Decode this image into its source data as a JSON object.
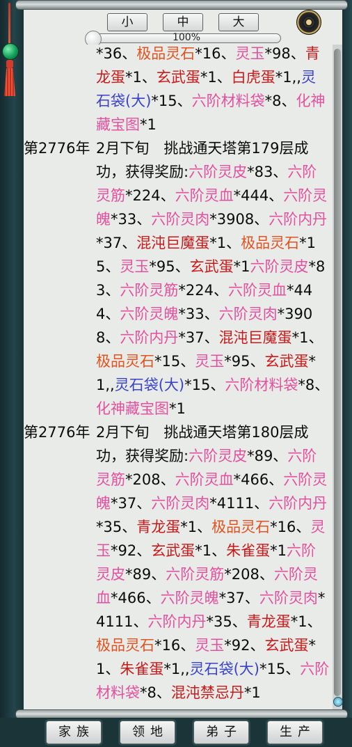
{
  "header": {
    "size_buttons": [
      "小",
      "中",
      "大"
    ]
  },
  "zoom": {
    "label": "100%",
    "value_percent": 100
  },
  "log_entries": [
    {
      "year": "",
      "segments": [
        {
          "t": "*36、",
          "c": "dark"
        },
        {
          "t": "极品灵石",
          "c": "orange"
        },
        {
          "t": "*16、",
          "c": "dark"
        },
        {
          "t": "灵玉",
          "c": "pink"
        },
        {
          "t": "*98、",
          "c": "dark"
        },
        {
          "t": "青龙蛋",
          "c": "red"
        },
        {
          "t": "*1、",
          "c": "dark"
        },
        {
          "t": "玄武蛋",
          "c": "red"
        },
        {
          "t": "*1、",
          "c": "dark"
        },
        {
          "t": "白虎蛋",
          "c": "red"
        },
        {
          "t": "*1,,",
          "c": "dark"
        },
        {
          "t": "灵石袋(大)",
          "c": "blue"
        },
        {
          "t": "*15、",
          "c": "dark"
        },
        {
          "t": "六阶材料袋",
          "c": "pink"
        },
        {
          "t": "*8、",
          "c": "dark"
        },
        {
          "t": "化神藏宝图",
          "c": "pink"
        },
        {
          "t": "*1",
          "c": "dark"
        }
      ]
    },
    {
      "year": "第2776年",
      "segments": [
        {
          "t": "2月下旬　挑战通天塔第179层成功，获得奖励:",
          "c": "dark"
        },
        {
          "t": "六阶灵皮",
          "c": "pink"
        },
        {
          "t": "*83、",
          "c": "dark"
        },
        {
          "t": "六阶灵筋",
          "c": "pink"
        },
        {
          "t": "*224、",
          "c": "dark"
        },
        {
          "t": "六阶灵血",
          "c": "pink"
        },
        {
          "t": "*444、",
          "c": "dark"
        },
        {
          "t": "六阶灵魄",
          "c": "pink"
        },
        {
          "t": "*33、",
          "c": "dark"
        },
        {
          "t": "六阶灵肉",
          "c": "pink"
        },
        {
          "t": "*3908、",
          "c": "dark"
        },
        {
          "t": "六阶内丹",
          "c": "pink"
        },
        {
          "t": "*37、",
          "c": "dark"
        },
        {
          "t": "混沌巨魔蛋",
          "c": "red"
        },
        {
          "t": "*1、",
          "c": "dark"
        },
        {
          "t": "极品灵石",
          "c": "orange"
        },
        {
          "t": "*15、",
          "c": "dark"
        },
        {
          "t": "灵玉",
          "c": "pink"
        },
        {
          "t": "*95、",
          "c": "dark"
        },
        {
          "t": "玄武蛋",
          "c": "red"
        },
        {
          "t": "*1",
          "c": "dark"
        },
        {
          "t": "六阶灵皮",
          "c": "pink"
        },
        {
          "t": "*83、",
          "c": "dark"
        },
        {
          "t": "六阶灵筋",
          "c": "pink"
        },
        {
          "t": "*224、",
          "c": "dark"
        },
        {
          "t": "六阶灵血",
          "c": "pink"
        },
        {
          "t": "*444、",
          "c": "dark"
        },
        {
          "t": "六阶灵魄",
          "c": "pink"
        },
        {
          "t": "*33、",
          "c": "dark"
        },
        {
          "t": "六阶灵肉",
          "c": "pink"
        },
        {
          "t": "*3908、",
          "c": "dark"
        },
        {
          "t": "六阶内丹",
          "c": "pink"
        },
        {
          "t": "*37、",
          "c": "dark"
        },
        {
          "t": "混沌巨魔蛋",
          "c": "red"
        },
        {
          "t": "*1、",
          "c": "dark"
        },
        {
          "t": "极品灵石",
          "c": "orange"
        },
        {
          "t": "*15、",
          "c": "dark"
        },
        {
          "t": "灵玉",
          "c": "pink"
        },
        {
          "t": "*95、",
          "c": "dark"
        },
        {
          "t": "玄武蛋",
          "c": "red"
        },
        {
          "t": "*1,,",
          "c": "dark"
        },
        {
          "t": "灵石袋(大)",
          "c": "blue"
        },
        {
          "t": "*15、",
          "c": "dark"
        },
        {
          "t": "六阶材料袋",
          "c": "pink"
        },
        {
          "t": "*8、",
          "c": "dark"
        },
        {
          "t": "化神藏宝图",
          "c": "pink"
        },
        {
          "t": "*1",
          "c": "dark"
        }
      ]
    },
    {
      "year": "第2776年",
      "segments": [
        {
          "t": "2月下旬　挑战通天塔第180层成功，获得奖励:",
          "c": "dark"
        },
        {
          "t": "六阶灵皮",
          "c": "pink"
        },
        {
          "t": "*89、",
          "c": "dark"
        },
        {
          "t": "六阶灵筋",
          "c": "pink"
        },
        {
          "t": "*208、",
          "c": "dark"
        },
        {
          "t": "六阶灵血",
          "c": "pink"
        },
        {
          "t": "*466、",
          "c": "dark"
        },
        {
          "t": "六阶灵魄",
          "c": "pink"
        },
        {
          "t": "*37、",
          "c": "dark"
        },
        {
          "t": "六阶灵肉",
          "c": "pink"
        },
        {
          "t": "*4111、",
          "c": "dark"
        },
        {
          "t": "六阶内丹",
          "c": "pink"
        },
        {
          "t": "*35、",
          "c": "dark"
        },
        {
          "t": "青龙蛋",
          "c": "red"
        },
        {
          "t": "*1、",
          "c": "dark"
        },
        {
          "t": "极品灵石",
          "c": "orange"
        },
        {
          "t": "*16、",
          "c": "dark"
        },
        {
          "t": "灵玉",
          "c": "pink"
        },
        {
          "t": "*92、",
          "c": "dark"
        },
        {
          "t": "玄武蛋",
          "c": "red"
        },
        {
          "t": "*1、",
          "c": "dark"
        },
        {
          "t": "朱雀蛋",
          "c": "red"
        },
        {
          "t": "*1",
          "c": "dark"
        },
        {
          "t": "六阶灵皮",
          "c": "pink"
        },
        {
          "t": "*89、",
          "c": "dark"
        },
        {
          "t": "六阶灵筋",
          "c": "pink"
        },
        {
          "t": "*208、",
          "c": "dark"
        },
        {
          "t": "六阶灵血",
          "c": "pink"
        },
        {
          "t": "*466、",
          "c": "dark"
        },
        {
          "t": "六阶灵魄",
          "c": "pink"
        },
        {
          "t": "*37、",
          "c": "dark"
        },
        {
          "t": "六阶灵肉",
          "c": "pink"
        },
        {
          "t": "*4111、",
          "c": "dark"
        },
        {
          "t": "六阶内丹",
          "c": "pink"
        },
        {
          "t": "*35、",
          "c": "dark"
        },
        {
          "t": "青龙蛋",
          "c": "red"
        },
        {
          "t": "*1、",
          "c": "dark"
        },
        {
          "t": "极品灵石",
          "c": "orange"
        },
        {
          "t": "*16、",
          "c": "dark"
        },
        {
          "t": "灵玉",
          "c": "pink"
        },
        {
          "t": "*92、",
          "c": "dark"
        },
        {
          "t": "玄武蛋",
          "c": "red"
        },
        {
          "t": "*1、",
          "c": "dark"
        },
        {
          "t": "朱雀蛋",
          "c": "red"
        },
        {
          "t": "*1,,",
          "c": "dark"
        },
        {
          "t": "灵石袋(大)",
          "c": "blue"
        },
        {
          "t": "*15、",
          "c": "dark"
        },
        {
          "t": "六阶材料袋",
          "c": "pink"
        },
        {
          "t": "*8、",
          "c": "dark"
        },
        {
          "t": "混沌禁忌丹",
          "c": "red"
        },
        {
          "t": "*1",
          "c": "dark"
        }
      ]
    }
  ],
  "bottom_nav": [
    "家族",
    "领地",
    "弟子",
    "生产"
  ],
  "colors": {
    "dark": "#0a0a0a",
    "pink": "#e2509e",
    "red": "#c81a1a",
    "orange": "#e2521f",
    "blue": "#3a42c8"
  }
}
